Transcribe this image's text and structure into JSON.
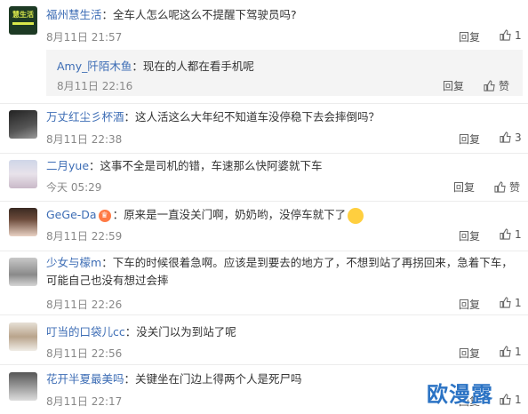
{
  "reply_label": "回复",
  "like_label": "赞",
  "comments": [
    {
      "name": "福州慧生活",
      "text": "：全车人怎么呢这么不提醒下驾驶员吗?",
      "time": "8月11日 21:57",
      "likes": "1"
    },
    {
      "name": "万丈红尘彡杯酒",
      "text": "：这人活这么大年纪不知道车没停稳下去会摔倒吗？",
      "time": "8月11日 22:38",
      "likes": "3"
    },
    {
      "name": "二月yue",
      "text": "：这事不全是司机的错，车速那么快阿婆就下车",
      "time": "今天 05:29",
      "likes": ""
    },
    {
      "name": "GeGe-Da",
      "text": "：原来是一直没关门啊，奶奶哟，没停车就下了",
      "time": "8月11日 22:59",
      "likes": "1"
    },
    {
      "name": "少女与檬m",
      "text": "：下车的时候很着急啊。应该是到要去的地方了，不想到站了再拐回来，急着下车，可能自己也没有想过会摔",
      "time": "8月11日 22:26",
      "likes": "1"
    },
    {
      "name": "叮当的口袋儿cc",
      "text": "：没关门以为到站了呢",
      "time": "8月11日 22:56",
      "likes": "1"
    },
    {
      "name": "花开半夏最美吗",
      "text": "：关键坐在门边上得两个人是死尸吗",
      "time": "8月11日 22:17",
      "likes": "1"
    }
  ],
  "subreply": {
    "name": "Amy_阡陌木鱼",
    "text": "：现在的人都在看手机呢",
    "time": "8月11日 22:16"
  },
  "avatar0_text": "慧生活",
  "watermark": "欧漫露"
}
